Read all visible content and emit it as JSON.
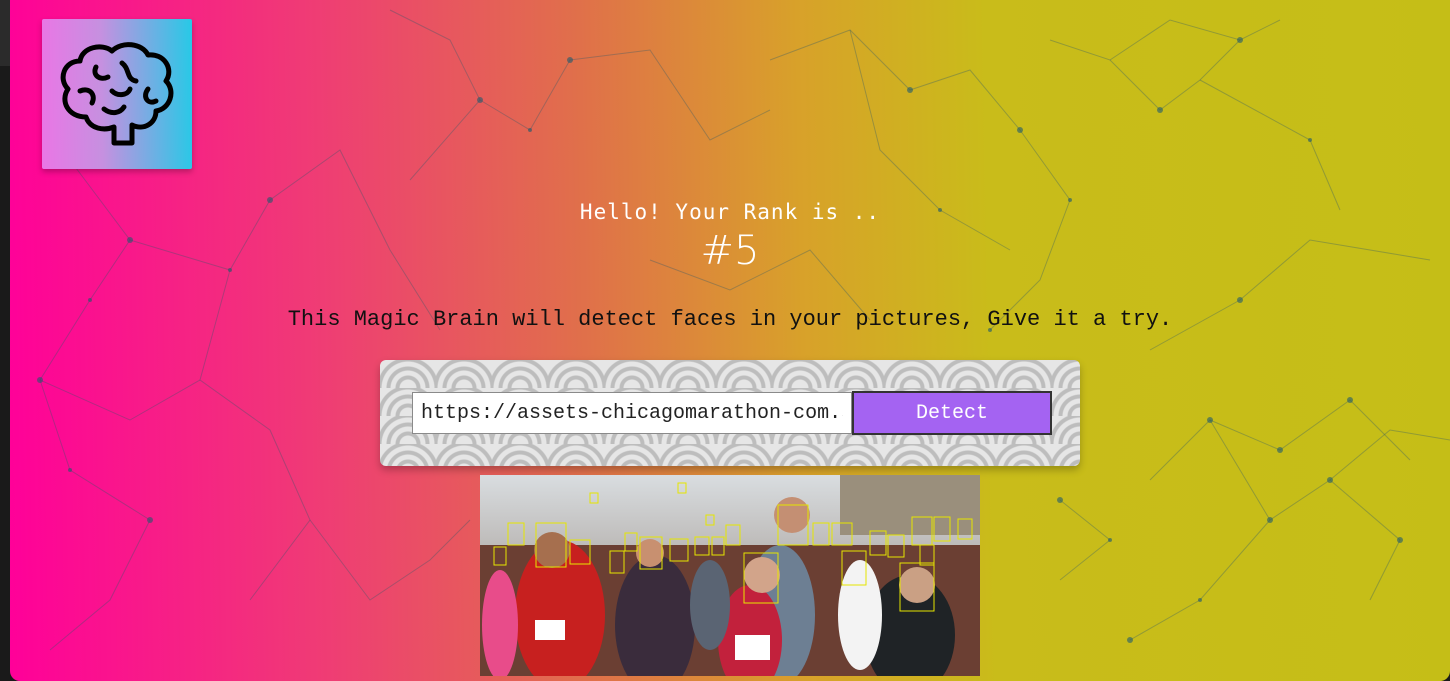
{
  "app": {
    "logo_icon": "brain-icon"
  },
  "rank": {
    "greeting": "Hello! Your Rank is ..",
    "value": "#5"
  },
  "intro": {
    "text": "This Magic Brain will detect faces in your pictures, Give it a try."
  },
  "form": {
    "url_value": "https://assets-chicagomarathon-com.s",
    "button_label": "Detect"
  },
  "result": {
    "image_subject": "marathon runners photo",
    "face_box_color": "#e5e600",
    "faces_detected_boxes": 26
  },
  "colors": {
    "gradient_left": "#ff0099",
    "gradient_right": "#c5be17",
    "button": "#a463f2",
    "logo_left": "#ea76e5",
    "logo_right": "#27c9e6"
  }
}
